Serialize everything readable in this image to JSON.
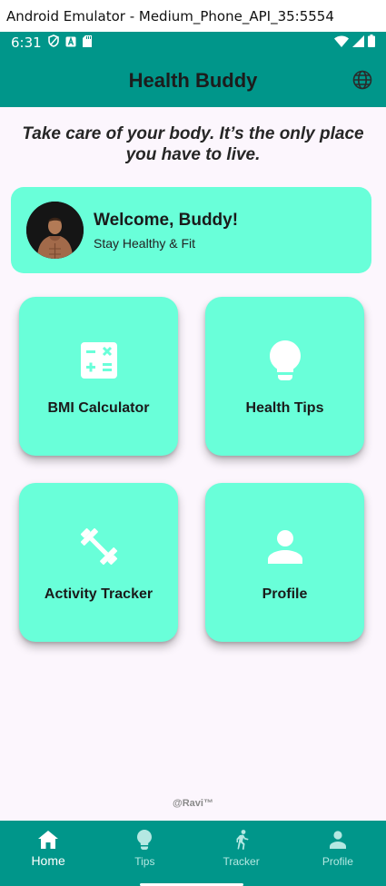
{
  "window": {
    "title": "Android Emulator - Medium_Phone_API_35:5554"
  },
  "status_bar": {
    "time": "6:31"
  },
  "app_bar": {
    "title": "Health Buddy",
    "language_icon": "globe-icon"
  },
  "quote": "Take care of your body. It’s the only place you have to live.",
  "welcome": {
    "title": "Welcome, Buddy!",
    "subtitle": "Stay Healthy & Fit"
  },
  "tiles": [
    {
      "label": "BMI Calculator",
      "icon": "calculator-icon"
    },
    {
      "label": "Health Tips",
      "icon": "lightbulb-icon"
    },
    {
      "label": "Activity Tracker",
      "icon": "dumbbell-icon"
    },
    {
      "label": "Profile",
      "icon": "person-icon"
    }
  ],
  "footer": {
    "credit": "@Ravi™"
  },
  "bottom_nav": {
    "items": [
      {
        "label": "Home",
        "icon": "home-icon",
        "active": true
      },
      {
        "label": "Tips",
        "icon": "lightbulb-icon",
        "active": false
      },
      {
        "label": "Tracker",
        "icon": "running-icon",
        "active": false
      },
      {
        "label": "Profile",
        "icon": "person-icon",
        "active": false
      }
    ]
  },
  "colors": {
    "primary": "#00968a",
    "card": "#69ffd9",
    "background": "#fcf6fd"
  }
}
